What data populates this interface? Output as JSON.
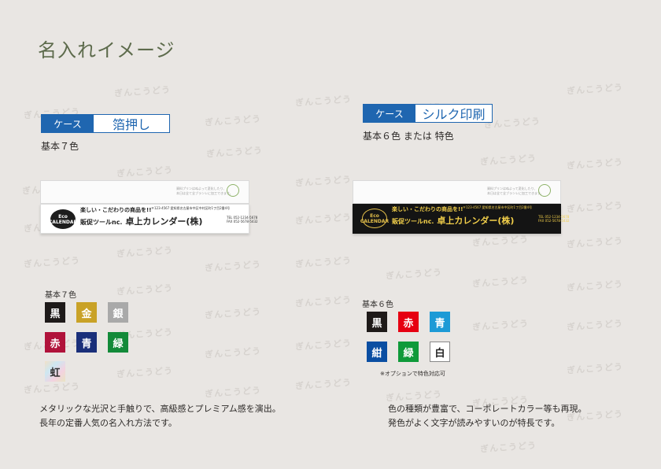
{
  "page": {
    "title": "名入れイメージ",
    "watermark": "ぎんこうどう"
  },
  "left": {
    "case_label": "ケース",
    "method": "箔押し",
    "subtitle": "基本７色",
    "product": {
      "logo_line1": "Eco",
      "logo_line2": "CALENDAR",
      "catch": "楽しい・こだわりの商品を!!",
      "shop_prefix": "販促ツールnc.",
      "shop_name": "卓上カレンダー(株)",
      "address": "〒123-4567 愛知県名古屋市中区中村区町1丁目2番4号",
      "tel": "TEL 052-1234-5678",
      "fax": "FAX 052-5678-5432",
      "fine_print": "資料プリンはぬよって変化したり、\n本日は全て全ブランレに加工できます。",
      "band_color": "#ffffff"
    },
    "colors_label": "基本７色",
    "colors": [
      {
        "label": "黒",
        "color": "#1e1a19"
      },
      {
        "label": "金",
        "color": "#c9a227"
      },
      {
        "label": "銀",
        "color": "#a9a9a9"
      },
      {
        "label": "赤",
        "color": "#b0123a"
      },
      {
        "label": "青",
        "color": "#1a2f7a"
      },
      {
        "label": "緑",
        "color": "#138a39"
      },
      {
        "label": "虹",
        "color": "#d9d3c0"
      }
    ],
    "description_line1": "メタリックな光沢と手触りで、高級感とプレミアム感を演出。",
    "description_line2": "長年の定番人気の名入れ方法です。"
  },
  "right": {
    "case_label": "ケース",
    "method": "シルク印刷",
    "subtitle": "基本６色 または 特色",
    "product": {
      "logo_line1": "Eco",
      "logo_line2": "CALENDAR",
      "catch": "楽しい・こだわりの商品を!!",
      "shop_prefix": "販促ツールnc.",
      "shop_name": "卓上カレンダー(株)",
      "address": "〒123-4567 愛知県名古屋市中区町1丁目2番4号",
      "tel": "TEL 052-1234-5678",
      "fax": "FAX 052-5678-5432",
      "fine_print": "資料プリンはぬよって変化したり、\n本日は全て全ブランレに加工できます。",
      "band_color": "#141414"
    },
    "colors_label": "基本６色",
    "colors": [
      {
        "label": "黒",
        "color": "#1e1a19"
      },
      {
        "label": "赤",
        "color": "#e60012"
      },
      {
        "label": "青",
        "color": "#1d9ad6"
      },
      {
        "label": "紺",
        "color": "#0a4ea2"
      },
      {
        "label": "緑",
        "color": "#0f9a3a"
      },
      {
        "label": "白",
        "color": "#ffffff"
      }
    ],
    "note": "※オプションで特色対応可",
    "description_line1": "色の種類が豊富で、コーポレートカラー等も再現。",
    "description_line2": "発色がよく文字が読みやすいのが特長です。"
  }
}
